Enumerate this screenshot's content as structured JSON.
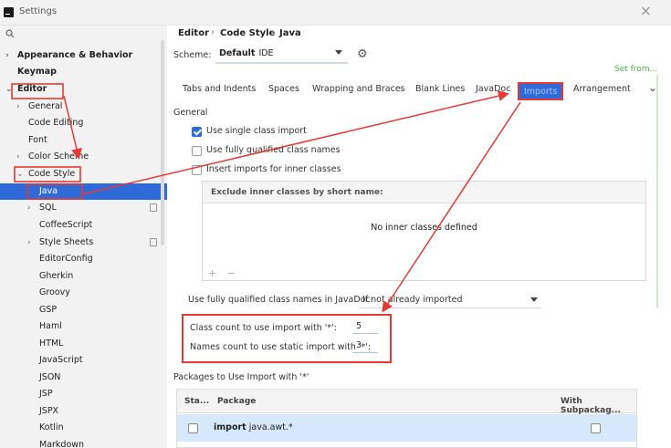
{
  "window": {
    "title": "Settings"
  },
  "sidebar": {
    "items": [
      {
        "label": "Appearance & Behavior",
        "bold": true,
        "arrow": "›"
      },
      {
        "label": "Keymap",
        "bold": true,
        "arrow": ""
      },
      {
        "label": "Editor",
        "bold": true,
        "arrow": "⌄"
      },
      {
        "label": "General",
        "arrow": "›"
      },
      {
        "label": "Code Editing",
        "arrow": ""
      },
      {
        "label": "Font",
        "arrow": ""
      },
      {
        "label": "Color Scheme",
        "arrow": "›"
      },
      {
        "label": "Code Style",
        "arrow": "⌄"
      },
      {
        "label": "Java",
        "arrow": "",
        "selected": true
      },
      {
        "label": "SQL",
        "arrow": "›",
        "copy_icon": true
      },
      {
        "label": "CoffeeScript",
        "arrow": ""
      },
      {
        "label": "Style Sheets",
        "arrow": "›",
        "copy_icon": true
      },
      {
        "label": "EditorConfig",
        "arrow": ""
      },
      {
        "label": "Gherkin",
        "arrow": ""
      },
      {
        "label": "Groovy",
        "arrow": ""
      },
      {
        "label": "GSP",
        "arrow": ""
      },
      {
        "label": "Haml",
        "arrow": ""
      },
      {
        "label": "HTML",
        "arrow": ""
      },
      {
        "label": "JavaScript",
        "arrow": ""
      },
      {
        "label": "JSON",
        "arrow": ""
      },
      {
        "label": "JSP",
        "arrow": ""
      },
      {
        "label": "JSPX",
        "arrow": ""
      },
      {
        "label": "Kotlin",
        "arrow": ""
      },
      {
        "label": "Markdown",
        "arrow": ""
      }
    ]
  },
  "breadcrumb": {
    "items": [
      "Editor",
      "Code Style",
      "Java"
    ],
    "separator": "›"
  },
  "scheme": {
    "label": "Scheme:",
    "value": "Default",
    "sub": "IDE"
  },
  "set_from": "Set from...",
  "tabs": [
    {
      "label": "Tabs and Indents"
    },
    {
      "label": "Spaces"
    },
    {
      "label": "Wrapping and Braces"
    },
    {
      "label": "Blank Lines"
    },
    {
      "label": "JavaDoc"
    },
    {
      "label": "Imports",
      "active": true
    },
    {
      "label": "Arrangement"
    }
  ],
  "general": {
    "title": "General",
    "options": [
      {
        "label": "Use single class import",
        "checked": true
      },
      {
        "label": "Use fully qualified class names",
        "checked": false
      },
      {
        "label": "Insert imports for inner classes",
        "checked": false
      }
    ]
  },
  "exclude": {
    "header": "Exclude inner classes by short name:",
    "empty_text": "No inner classes defined",
    "add": "+",
    "remove": "−"
  },
  "javadoc_fq": {
    "label": "Use fully qualified class names in JavaDoc:",
    "value": "If not already imported"
  },
  "counts": {
    "class_label": "Class count to use import with '*':",
    "class_value": "5",
    "static_label": "Names count to use static import with '*':",
    "static_value": "3"
  },
  "packages": {
    "title": "Packages to Use Import with '*'",
    "columns": [
      "Sta...",
      "Package",
      "With Subpackag..."
    ],
    "rows": [
      {
        "keyword": "import",
        "name": "java.awt.*"
      }
    ]
  },
  "colors": {
    "accent": "#2f6bd8",
    "annotation": "#e53935",
    "set_from": "#4caf50"
  }
}
